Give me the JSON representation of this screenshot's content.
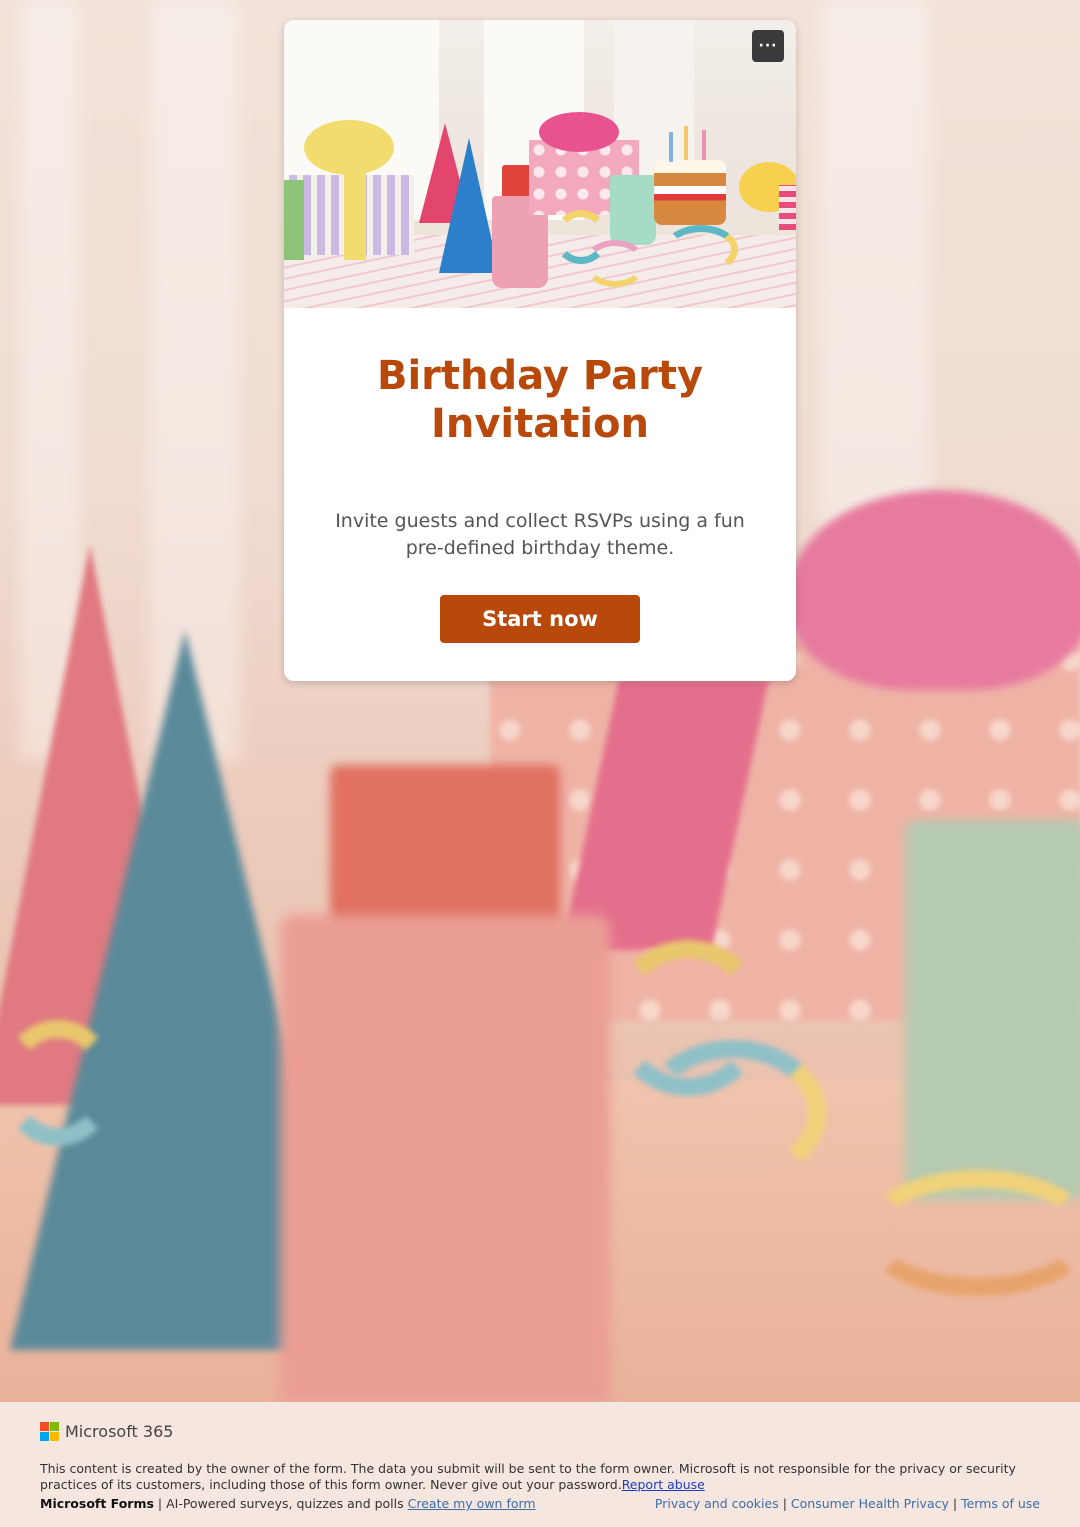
{
  "form": {
    "title": "Birthday Party Invitation",
    "description": "Invite guests and collect RSVPs using a fun pre-defined birthday theme.",
    "start_button": "Start now",
    "more_options_label": "···",
    "accent_color": "#b8490b"
  },
  "footer": {
    "brand": "Microsoft 365",
    "disclaimer": "This content is created by the owner of the form. The data you submit will be sent to the form owner. Microsoft is not responsible for the privacy or security practices of its customers, including those of this form owner. Never give out your password.",
    "report_abuse": "Report abuse",
    "product_name": "Microsoft Forms",
    "product_tagline": " | AI-Powered surveys, quizzes and polls ",
    "create_form": "Create my own form",
    "privacy": "Privacy and cookies",
    "consumer_health": "Consumer Health Privacy",
    "terms": "Terms of use",
    "separator": " | "
  },
  "icons": {
    "more": "more-options-icon",
    "logo": "microsoft-logo-icon"
  }
}
